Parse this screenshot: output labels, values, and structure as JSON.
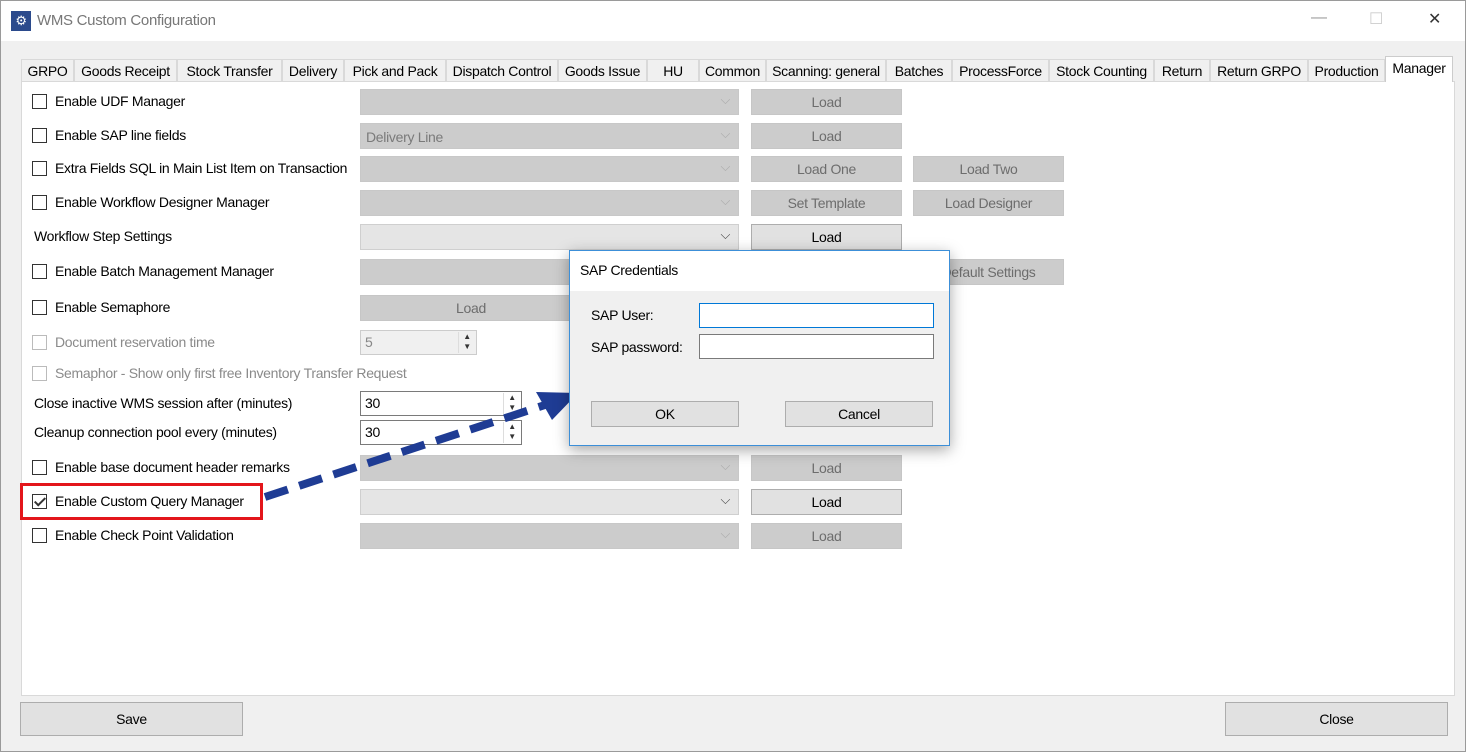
{
  "window": {
    "title": "WMS Custom Configuration",
    "minimize": "—",
    "maximize": "☐",
    "close": "✕"
  },
  "tabs": [
    "GRPO",
    "Goods Receipt",
    "Stock Transfer",
    "Delivery",
    "Pick and Pack",
    "Dispatch Control",
    "Goods Issue",
    "HU",
    "Common",
    "Scanning: general",
    "Batches",
    "ProcessForce",
    "Stock Counting",
    "Return",
    "Return GRPO",
    "Production",
    "Manager"
  ],
  "selected_tab": "Manager",
  "rows": [
    {
      "label": "Enable UDF Manager",
      "checkbox": true,
      "dropdown": {
        "value": "",
        "enabled": false
      },
      "buttons": [
        {
          "label": "Load",
          "enabled": false
        }
      ]
    },
    {
      "label": "Enable SAP line fields",
      "checkbox": true,
      "dropdown": {
        "value": "Delivery Line",
        "enabled": false
      },
      "buttons": [
        {
          "label": "Load",
          "enabled": false
        }
      ]
    },
    {
      "label": "Extra Fields SQL in Main List Item on Transaction",
      "checkbox": true,
      "dropdown": {
        "value": "",
        "enabled": false
      },
      "buttons": [
        {
          "label": "Load One",
          "enabled": false
        },
        {
          "label": "Load Two",
          "enabled": false
        }
      ]
    },
    {
      "label": "Enable Workflow Designer Manager",
      "checkbox": true,
      "dropdown": {
        "value": "",
        "enabled": false
      },
      "buttons": [
        {
          "label": "Set Template",
          "enabled": false
        },
        {
          "label": "Load Designer",
          "enabled": false
        }
      ]
    },
    {
      "label": "Workflow Step Settings",
      "checkbox": false,
      "dropdown": {
        "value": "",
        "enabled": true
      },
      "buttons": [
        {
          "label": "Load",
          "enabled": true
        }
      ]
    },
    {
      "label": "Enable Batch Management Manager",
      "checkbox": true,
      "dropdown": {
        "value": "",
        "enabled": false
      },
      "buttons": [
        {
          "label": "",
          "enabled": false
        },
        {
          "label": "Default Settings",
          "enabled": false
        }
      ]
    },
    {
      "label": "Enable Semaphore",
      "checkbox": true,
      "wide_button": {
        "label": "Load",
        "enabled": false
      }
    },
    {
      "label": "Document reservation time",
      "checkbox": true,
      "disabled": true,
      "spin": {
        "value": "5",
        "enabled": false
      }
    },
    {
      "label": "Semaphor - Show only first free Inventory Transfer Request",
      "checkbox": true,
      "disabled": true
    },
    {
      "label": "Close inactive WMS session after (minutes)",
      "checkbox": false,
      "spin": {
        "value": "30",
        "enabled": true
      }
    },
    {
      "label": "Cleanup connection pool every (minutes)",
      "checkbox": false,
      "spin": {
        "value": "30",
        "enabled": true
      }
    },
    {
      "label": "Enable base document header remarks",
      "checkbox": true,
      "dropdown": {
        "value": "",
        "enabled": false
      },
      "buttons": [
        {
          "label": "Load",
          "enabled": false
        }
      ]
    },
    {
      "label": "Enable Custom Query Manager",
      "checkbox": true,
      "checked": true,
      "dropdown": {
        "value": "",
        "enabled": true
      },
      "buttons": [
        {
          "label": "Load",
          "enabled": true
        }
      ]
    },
    {
      "label": "Enable Check Point Validation",
      "checkbox": true,
      "dropdown": {
        "value": "",
        "enabled": false
      },
      "buttons": [
        {
          "label": "Load",
          "enabled": false
        }
      ]
    }
  ],
  "footer": {
    "save": "Save",
    "close": "Close"
  },
  "dialog": {
    "title": "SAP Credentials",
    "user_label": "SAP User:",
    "user_value": "",
    "password_label": "SAP password:",
    "password_value": "",
    "ok": "OK",
    "cancel": "Cancel"
  },
  "annotation": {
    "highlight_color": "#e3161b",
    "arrow_color": "#1f3c94"
  }
}
